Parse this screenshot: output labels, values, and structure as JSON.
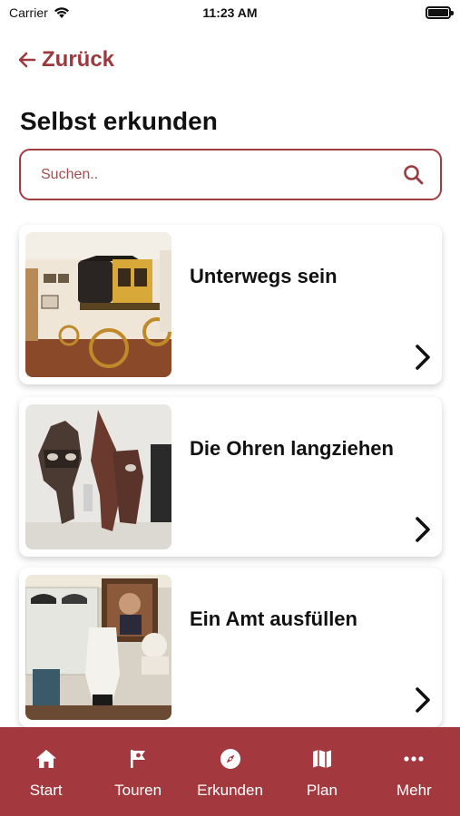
{
  "status": {
    "carrier": "Carrier",
    "time": "11:23 AM"
  },
  "nav": {
    "back_label": "Zurück"
  },
  "page": {
    "title": "Selbst erkunden"
  },
  "search": {
    "placeholder": "Suchen.."
  },
  "cards": [
    {
      "title": "Unterwegs sein",
      "image": "stagecoach-photo"
    },
    {
      "title": "Die Ohren langziehen",
      "image": "masks-photo"
    },
    {
      "title": "Ein Amt ausfüllen",
      "image": "uniform-exhibit-photo"
    }
  ],
  "tabbar": {
    "items": [
      {
        "label": "Start",
        "icon": "home-icon"
      },
      {
        "label": "Touren",
        "icon": "flag-icon"
      },
      {
        "label": "Erkunden",
        "icon": "compass-icon"
      },
      {
        "label": "Plan",
        "icon": "map-icon"
      },
      {
        "label": "Mehr",
        "icon": "more-icon"
      }
    ]
  },
  "colors": {
    "accent": "#a3393f",
    "text": "#111111",
    "background": "#ffffff"
  }
}
